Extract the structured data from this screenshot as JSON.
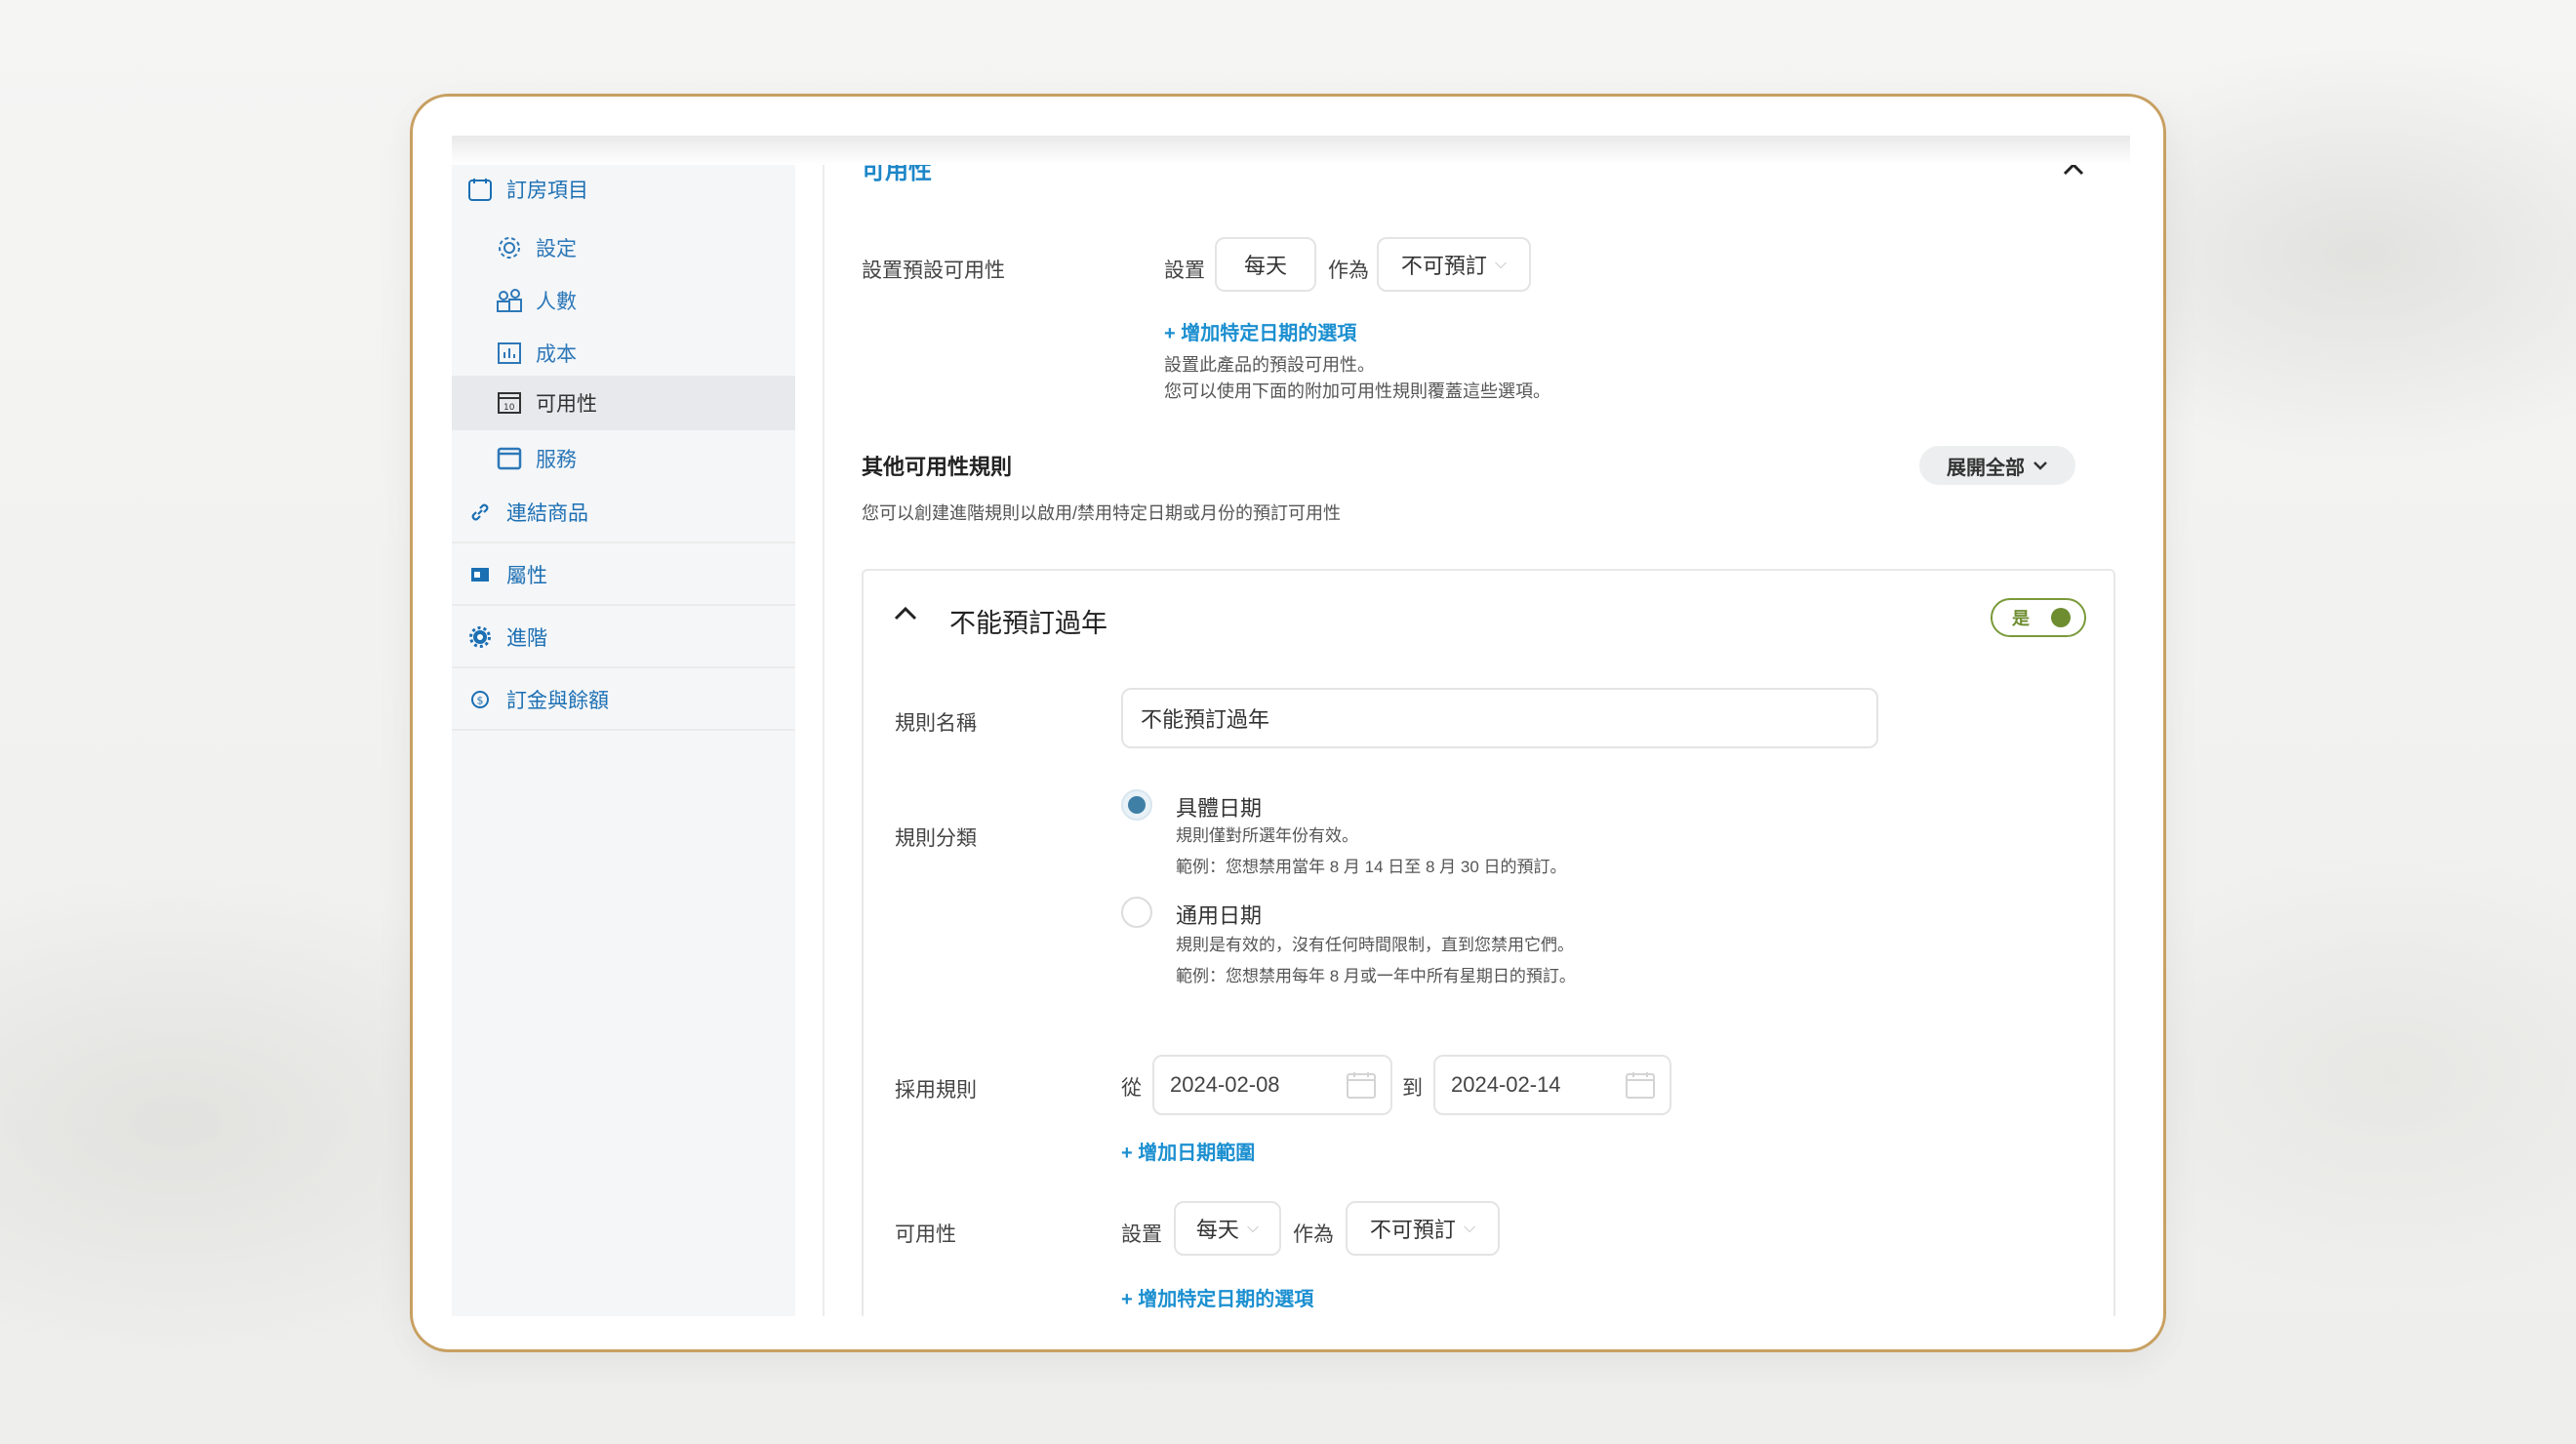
{
  "sidebar": {
    "items": [
      {
        "label": "訂房項目",
        "icon": "calendar-icon"
      },
      {
        "label": "設定",
        "icon": "gear-icon"
      },
      {
        "label": "人數",
        "icon": "people-icon"
      },
      {
        "label": "成本",
        "icon": "chart-icon"
      },
      {
        "label": "可用性",
        "icon": "calendar-date-icon"
      },
      {
        "label": "服務",
        "icon": "window-icon"
      },
      {
        "label": "連結商品",
        "icon": "link-icon"
      },
      {
        "label": "屬性",
        "icon": "card-icon"
      },
      {
        "label": "進階",
        "icon": "cog-icon"
      },
      {
        "label": "訂金與餘額",
        "icon": "coin-icon"
      }
    ]
  },
  "availability": {
    "section_title": "可用性",
    "default_label": "設置預設可用性",
    "set_label": "設置",
    "period_value": "每天",
    "as_label": "作為",
    "status_value": "不可預訂",
    "add_date_option": "+ 增加特定日期的選項",
    "note_line1": "設置此產品的預設可用性。",
    "note_line2": "您可以使用下面的附加可用性規則覆蓋這些選項。",
    "other_rules_title": "其他可用性規則",
    "other_rules_desc": "您可以創建進階規則以啟用/禁用特定日期或月份的預訂可用性",
    "expand_all": "展開全部"
  },
  "rule": {
    "title": "不能預訂過年",
    "toggle_label": "是",
    "toggle_on": true,
    "name_label": "規則名稱",
    "name_value": "不能預訂過年",
    "category_label": "規則分類",
    "option1_title": "具體日期",
    "option1_desc1": "規則僅對所選年份有效。",
    "option1_desc2": "範例：您想禁用當年 8 月 14 日至 8 月 30 日的預訂。",
    "option2_title": "通用日期",
    "option2_desc1": "規則是有效的，沒有任何時間限制，直到您禁用它們。",
    "option2_desc2": "範例：您想禁用每年 8 月或一年中所有星期日的預訂。",
    "apply_label": "採用規則",
    "from_label": "從",
    "from_date": "2024-02-08",
    "to_label": "到",
    "to_date": "2024-02-14",
    "add_range": "+ 增加日期範圍",
    "avail_label": "可用性",
    "set_label": "設置",
    "period_value": "每天",
    "as_label": "作為",
    "status_value": "不可預訂",
    "add_date_option": "+ 增加特定日期的選項"
  },
  "colors": {
    "accent_blue": "#1b8fd0",
    "frame_gold": "#c8a062",
    "toggle_green": "#6e8d30"
  }
}
